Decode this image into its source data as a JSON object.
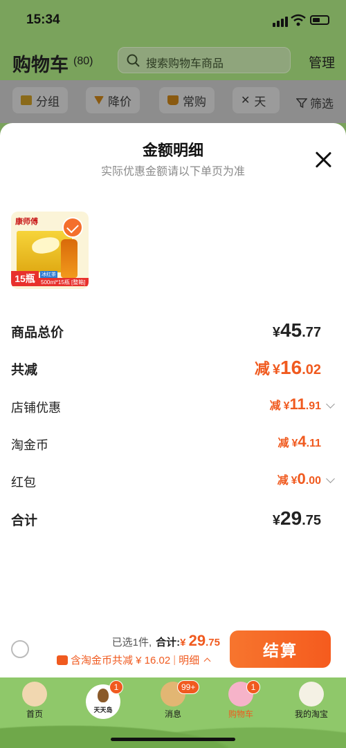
{
  "status_bar": {
    "time": "15:34"
  },
  "header": {
    "title": "购物车",
    "count": "(80)",
    "search_placeholder": "搜索购物车商品",
    "manage": "管理"
  },
  "filters": {
    "chips": [
      "分组",
      "降价",
      "常购",
      "天"
    ],
    "filter": "筛选"
  },
  "sheet": {
    "title": "金额明细",
    "subtitle": "实际优惠金额请以下单页为准",
    "product": {
      "brand": "康师傅",
      "qty_badge": "15瓶",
      "spec": "500ml*15瓶 [整箱]",
      "tag": "冰红茶",
      "selected": true
    },
    "rows": [
      {
        "label": "商品总价",
        "prefix": "",
        "currency": "¥",
        "int": "45",
        "dec": ".77"
      },
      {
        "label": "共减",
        "prefix": "减",
        "currency": "¥",
        "int": "16",
        "dec": ".02"
      },
      {
        "label": "店铺优惠",
        "prefix": "减",
        "currency": "¥",
        "int": "11",
        "dec": ".91"
      },
      {
        "label": "淘金币",
        "prefix": "减",
        "currency": "¥",
        "int": "4",
        "dec": ".11"
      },
      {
        "label": "红包",
        "prefix": "减",
        "currency": "¥",
        "int": "0",
        "dec": ".00"
      },
      {
        "label": "合计",
        "prefix": "",
        "currency": "¥",
        "int": "29",
        "dec": ".75"
      }
    ],
    "footer": {
      "selected_text": "已选1件,",
      "total_label": "合计:",
      "total_currency": "¥",
      "total_int": "29",
      "total_dec": ".75",
      "discount_text": "含淘金币共减 ¥ 16.02",
      "detail": "明细",
      "pay_button": "结算"
    }
  },
  "tabbar": {
    "tabs": [
      {
        "label": "首页",
        "badge": ""
      },
      {
        "label": "",
        "badge": "1",
        "logo_text": "天天岛"
      },
      {
        "label": "消息",
        "badge": "99+"
      },
      {
        "label": "购物车",
        "badge": "1"
      },
      {
        "label": "我的淘宝",
        "badge": ""
      }
    ]
  },
  "colors": {
    "accent": "#f05a1f",
    "header_green": "#7aa35c"
  }
}
